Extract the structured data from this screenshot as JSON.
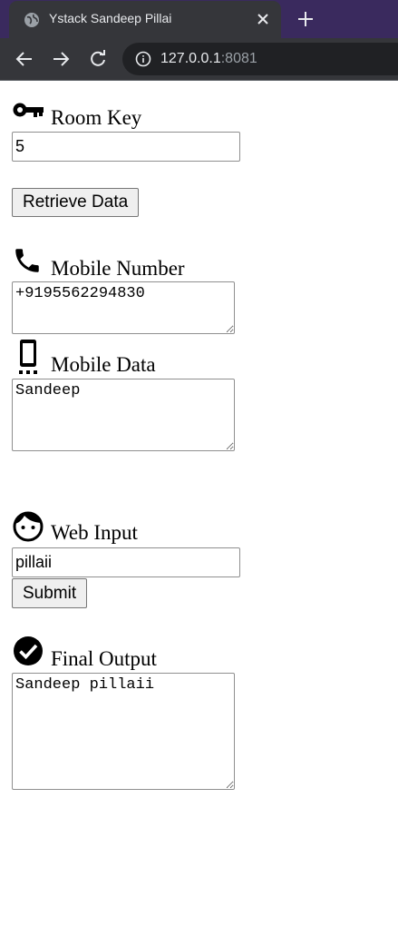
{
  "browser": {
    "tab_title": "Ystack Sandeep Pillai",
    "url_host": "127.0.0.1",
    "url_port": ":8081"
  },
  "room_key": {
    "label": "Room Key",
    "value": "5",
    "icon": "key-icon"
  },
  "retrieve_button": "Retrieve Data",
  "mobile_number": {
    "label": "Mobile Number",
    "value": "+9195562294830",
    "icon": "phone-icon"
  },
  "mobile_data": {
    "label": "Mobile Data",
    "value": "Sandeep",
    "icon": "mobile-device-icon"
  },
  "web_input": {
    "label": "Web Input",
    "value": "pillaii",
    "icon": "face-icon"
  },
  "submit_button": "Submit",
  "final_output": {
    "label": "Final Output",
    "value": "Sandeep pillaii",
    "icon": "check-circle-icon"
  }
}
